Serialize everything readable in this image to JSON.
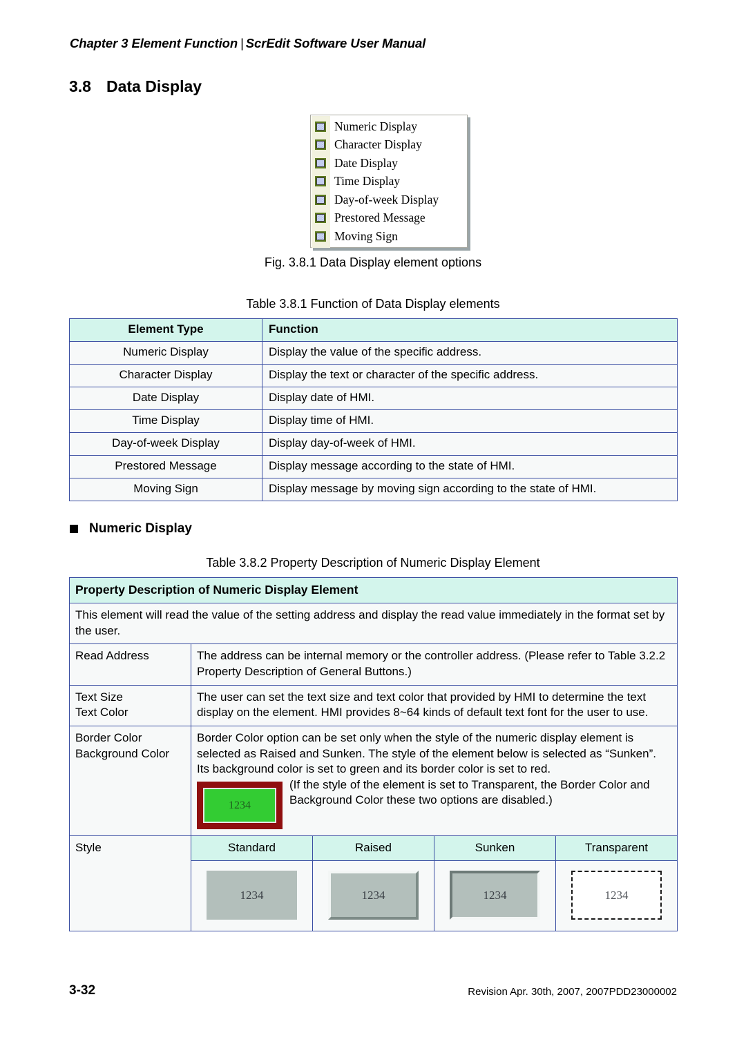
{
  "header": {
    "chapter": "Chapter 3  Element Function",
    "separator": "|",
    "manual": "ScrEdit Software User Manual"
  },
  "section": {
    "number": "3.8",
    "title": "Data Display"
  },
  "figure": {
    "caption": "Fig. 3.8.1 Data Display element options",
    "menu_items": [
      {
        "icon": "element-swatch-icon",
        "label": "Numeric Display"
      },
      {
        "icon": "element-swatch-icon",
        "label": "Character Display"
      },
      {
        "icon": "element-swatch-icon",
        "label": "Date Display"
      },
      {
        "icon": "element-swatch-icon",
        "label": "Time Display"
      },
      {
        "icon": "element-swatch-icon",
        "label": "Day-of-week Display"
      },
      {
        "icon": "element-swatch-icon",
        "label": "Prestored Message"
      },
      {
        "icon": "element-swatch-icon",
        "label": "Moving Sign"
      }
    ]
  },
  "table1": {
    "caption": "Table 3.8.1 Function of Data Display elements",
    "headers": [
      "Element Type",
      "Function"
    ],
    "rows": [
      [
        "Numeric Display",
        "Display the value of the specific address."
      ],
      [
        "Character Display",
        "Display the text or character of the specific address."
      ],
      [
        "Date Display",
        "Display date of HMI."
      ],
      [
        "Time Display",
        "Display time of HMI."
      ],
      [
        "Day-of-week Display",
        "Display day-of-week of HMI."
      ],
      [
        "Prestored Message",
        "Display message according to the state of HMI."
      ],
      [
        "Moving Sign",
        "Display message by moving sign according to the state of HMI."
      ]
    ]
  },
  "bullet_heading": "Numeric Display",
  "table2": {
    "caption": "Table 3.8.2 Property Description of Numeric Display Element",
    "title": "Property Description of Numeric Display Element",
    "intro": "This element will read the value of the setting address and display the read value immediately in the format set by the user.",
    "read_address": {
      "label": "Read Address",
      "text": "The address can be internal memory or the controller address. (Please refer to Table 3.2.2 Property Description of General Buttons.)"
    },
    "text_props": {
      "label_1": "Text Size",
      "label_2": "Text Color",
      "text": "The user can set the text size and text color that provided by HMI to determine the text display on the element. HMI provides 8~64 kinds of default text font for the user to use."
    },
    "color_props": {
      "label_1": "Border Color",
      "label_2": "Background Color",
      "text": "Border Color option can be set only when the style of the numeric display element is selected as Raised and Sunken. The style of the element below is selected as “Sunken”. Its background color is set to green and its border color is set to red.",
      "sample_value": "1234",
      "sample_background_color": "#33CC33",
      "sample_border_color": "#8F0F0F",
      "text_after": "(If the style of the element is set to Transparent, the Border Color and Background Color these two options are disabled.)"
    },
    "style": {
      "label": "Style",
      "columns": [
        "Standard",
        "Raised",
        "Sunken",
        "Transparent"
      ],
      "sample_value": "1234",
      "sample_fill_color": "#B3BFBB"
    }
  },
  "footer": {
    "page_number": "3-32",
    "revision": "Revision Apr. 30th, 2007, 2007PDD23000002"
  }
}
